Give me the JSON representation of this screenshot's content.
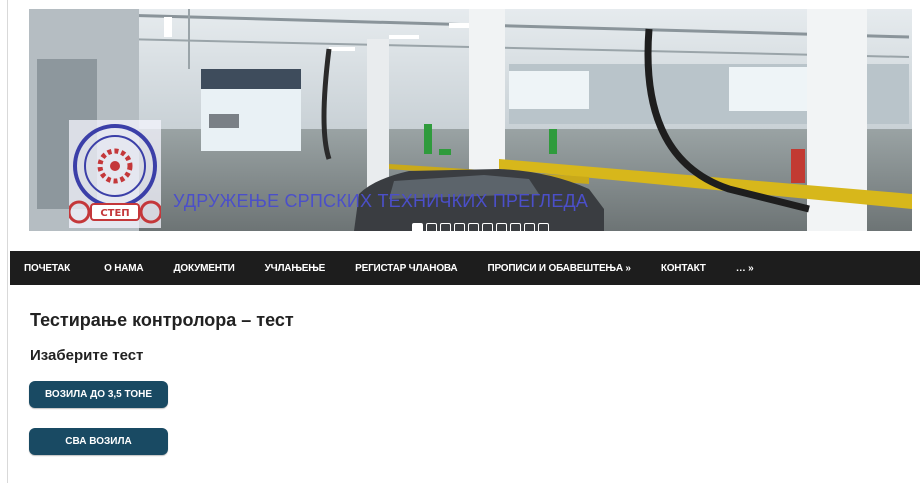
{
  "banner": {
    "org_title": "УДРУЖЕЊЕ СРПСКИХ ТЕХНИЧКИХ ПРЕГЛЕДА",
    "logo_text": "СТЕП",
    "slide_count": 10,
    "active_slide": 1
  },
  "nav": {
    "items": [
      "ПОЧЕТАК",
      "О НАМА",
      "ДОКУМЕНТИ",
      "УЧЛАЊЕЊЕ",
      "РЕГИСТАР ЧЛАНОВА",
      "ПРОПИСИ И ОБАВЕШТЕЊА »",
      "КОНТАКТ",
      "… »"
    ]
  },
  "main": {
    "title": "Тестирање контролора – тест",
    "subtitle": "Изаберите тест",
    "buttons": [
      "ВОЗИЛА ДО 3,5 ТОНЕ",
      "СВА ВОЗИЛА"
    ]
  },
  "colors": {
    "nav_bg": "#1d1d1d",
    "button_bg": "#194a63",
    "org_title": "#4b4fc9"
  }
}
